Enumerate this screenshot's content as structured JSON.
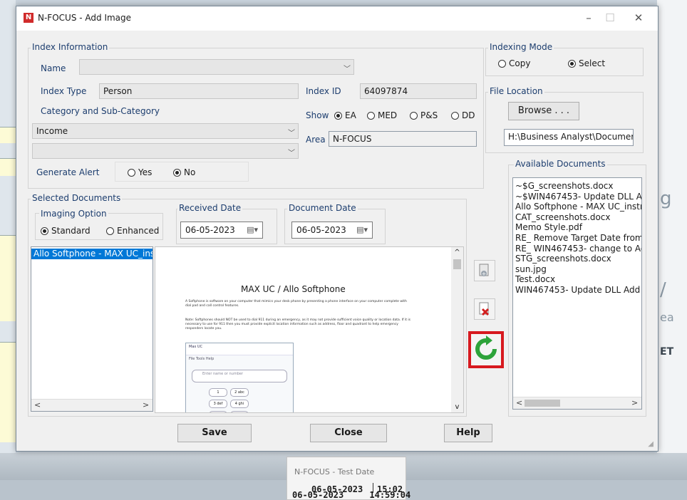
{
  "window": {
    "title": "N-FOCUS - Add Image",
    "minimize": "–",
    "maximize": "☐",
    "close": "✕"
  },
  "index_info": {
    "group_label": "Index Information",
    "name_label": "Name",
    "name_value": "",
    "index_type_label": "Index Type",
    "index_type_value": "Person",
    "index_id_label": "Index ID",
    "index_id_value": "64097874",
    "category_label": "Category  and  Sub-Category",
    "show_label": "Show",
    "show_options": [
      "EA",
      "MED",
      "P&S",
      "DD"
    ],
    "category_value": "Income",
    "subcategory_value": "",
    "area_label": "Area",
    "area_value": "N-FOCUS",
    "alert_label": "Generate Alert",
    "alert_yes": "Yes",
    "alert_no": "No"
  },
  "indexing_mode": {
    "label": "Indexing Mode",
    "copy": "Copy",
    "select": "Select"
  },
  "file_location": {
    "label": "File Location",
    "browse": "Browse . . .",
    "path": "H:\\Business Analyst\\Documer"
  },
  "available_documents": {
    "label": "Available Documents",
    "items": [
      "~$G_screenshots.docx",
      "~$WIN467453- Update DLL Add",
      "Allo Softphone - MAX UC_instr",
      "CAT_screenshots.docx",
      "Memo Style.pdf",
      "RE_ Remove Target Date from '",
      "RE_ WIN467453- change to Adc",
      "STG_screenshots.docx",
      "sun.jpg",
      "Test.docx",
      "WIN467453- Update DLL Add In"
    ]
  },
  "selected_documents": {
    "label": "Selected Documents",
    "imaging_label": "Imaging Option",
    "standard": "Standard",
    "enhanced": "Enhanced",
    "received_label": "Received Date",
    "received_value": "06-05-2023",
    "document_label": "Document Date",
    "document_value": "06-05-2023",
    "items": [
      "Allo Softphone - MAX UC_ins"
    ]
  },
  "preview": {
    "heading": "MAX UC / Allo Softphone",
    "para1": "A Softphone is software on your computer that mimics your desk phone by presenting a phone interface on your computer complete with dial pad and call control features.",
    "note": "Note:  Softphones should NOT be used to dial 911 during an emergency, as it may not provide sufficient voice quality or location data.  If it is necessary to use for 911 then you must provide explicit location information such as address, floor and quadrant to help emergency responders locate you.",
    "app_title": "Max UC",
    "app_menu": "File   Tools   Help",
    "app_input": "Enter name or number",
    "keys": [
      "1",
      "2 abc",
      "3 def",
      "4 ghi",
      "5 jkl",
      "6 mno"
    ]
  },
  "buttons": {
    "save": "Save",
    "close": "Close",
    "help": "Help"
  },
  "taskbar_popup": {
    "title": "N-FOCUS - Test Date",
    "date": "06-05-2023",
    "time": "15:02"
  },
  "status_time": "06-05-2023     14:59:04"
}
